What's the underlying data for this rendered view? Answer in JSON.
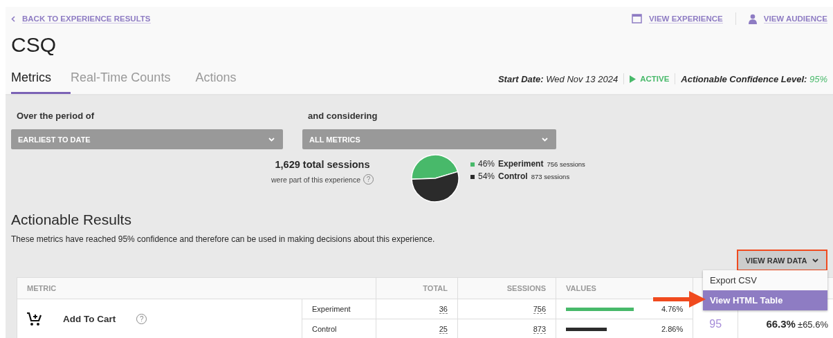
{
  "back_link": {
    "label": "BACK TO EXPERIENCE RESULTS"
  },
  "title": "CSQ",
  "header_links": [
    {
      "kind": "experience",
      "label": "VIEW EXPERIENCE"
    },
    {
      "kind": "audience",
      "label": "VIEW AUDIENCE"
    }
  ],
  "tabs": [
    {
      "label": "Metrics",
      "selected": true
    },
    {
      "label": "Real-Time Counts",
      "selected": false
    },
    {
      "label": "Actions",
      "selected": false
    }
  ],
  "status": {
    "start_label": "Start Date:",
    "start_value": "Wed Nov 13 2024",
    "state": "ACTIVE",
    "confidence_label": "Actionable Confidence Level:",
    "confidence_value": "95%"
  },
  "filters": [
    {
      "label": "Over the period of",
      "value": "EARLIEST TO DATE"
    },
    {
      "label": "and considering",
      "value": "ALL METRICS"
    }
  ],
  "sessions": {
    "total": "1,629 total sessions",
    "note": "were part of this experience",
    "help": "?",
    "chart_data": {
      "type": "pie",
      "categories": [
        "Experiment",
        "Control"
      ],
      "values": [
        46,
        54
      ]
    },
    "legend": [
      {
        "percent": "46%",
        "count": "756 sessions",
        "color": "#48b96a"
      },
      {
        "percent": "54%",
        "count": "873 sessions",
        "color": "#2b2b2b"
      }
    ]
  },
  "results": {
    "heading": "Actionable Results",
    "description": "These metrics have reached 95% confidence and therefore can be used in making decisions about this experience."
  },
  "raw_data_button": {
    "label": "VIEW RAW DATA",
    "highlighted": true
  },
  "raw_data_menu": [
    {
      "label": "Export CSV",
      "selected": false
    },
    {
      "label": "View HTML Table",
      "selected": true
    }
  ],
  "table": {
    "columns": [
      "METRIC",
      "TOTAL",
      "SESSIONS",
      "VALUES"
    ],
    "rows": [
      {
        "metric": "Add To Cart",
        "help": "?",
        "confidence": "95",
        "lift": "66.3%",
        "lift_margin": "±65.6%",
        "groups": [
          {
            "name": "Experiment",
            "total": "36",
            "sessions": "756",
            "value": "4.76%",
            "color": "#48b96a"
          },
          {
            "name": "Control",
            "total": "25",
            "sessions": "873",
            "value": "2.86%",
            "color": "#2b2b2b"
          }
        ]
      }
    ]
  }
}
